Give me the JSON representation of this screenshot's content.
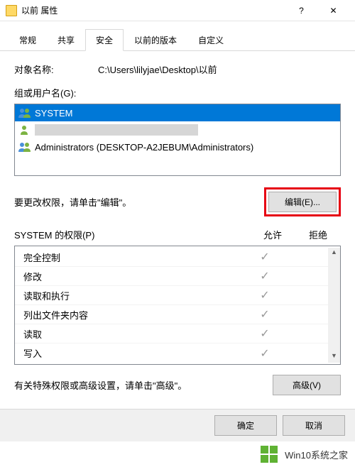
{
  "window": {
    "title": "以前 属性"
  },
  "tabs": [
    {
      "label": "常规",
      "active": false
    },
    {
      "label": "共享",
      "active": false
    },
    {
      "label": "安全",
      "active": true
    },
    {
      "label": "以前的版本",
      "active": false
    },
    {
      "label": "自定义",
      "active": false
    }
  ],
  "object": {
    "label": "对象名称:",
    "value": "C:\\Users\\lilyjae\\Desktop\\以前"
  },
  "groups": {
    "label": "组或用户名(G):",
    "items": [
      {
        "name": "SYSTEM",
        "type": "multi",
        "selected": true
      },
      {
        "name": "",
        "type": "single",
        "redacted": true
      },
      {
        "name": "Administrators (DESKTOP-A2JEBUM\\Administrators)",
        "type": "multi"
      }
    ]
  },
  "edit": {
    "text": "要更改权限，请单击\"编辑\"。",
    "button": "编辑(E)..."
  },
  "permissions": {
    "header": {
      "name": "SYSTEM 的权限(P)",
      "allow": "允许",
      "deny": "拒绝"
    },
    "rows": [
      {
        "name": "完全控制",
        "allow": true,
        "deny": false
      },
      {
        "name": "修改",
        "allow": true,
        "deny": false
      },
      {
        "name": "读取和执行",
        "allow": true,
        "deny": false
      },
      {
        "name": "列出文件夹内容",
        "allow": true,
        "deny": false
      },
      {
        "name": "读取",
        "allow": true,
        "deny": false
      },
      {
        "name": "写入",
        "allow": true,
        "deny": false
      }
    ]
  },
  "advanced": {
    "text": "有关特殊权限或高级设置，请单击\"高级\"。",
    "button": "高级(V)"
  },
  "buttons": {
    "ok": "确定",
    "cancel": "取消"
  },
  "footer": {
    "text": "Win10系统之家"
  }
}
